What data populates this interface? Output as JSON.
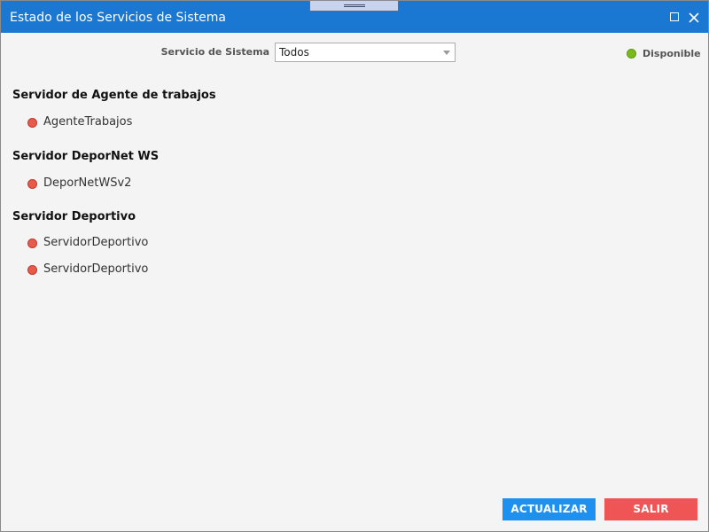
{
  "window": {
    "title": "Estado de los Servicios de Sistema"
  },
  "filter": {
    "label": "Servicio de Sistema",
    "selected": "Todos"
  },
  "legend": {
    "label": "Disponible",
    "color": "#7cba1c"
  },
  "colors": {
    "titlebar": "#1a77d2",
    "status_down": "#e85a4a",
    "refresh_button": "#1e90f0",
    "exit_button": "#ef5555"
  },
  "groups": [
    {
      "title": "Servidor de Agente de trabajos",
      "services": [
        {
          "name": "AgenteTrabajos",
          "status": "no-disponible"
        }
      ]
    },
    {
      "title": "Servidor DeporNet WS",
      "services": [
        {
          "name": "DeporNetWSv2",
          "status": "no-disponible"
        }
      ]
    },
    {
      "title": "Servidor Deportivo",
      "services": [
        {
          "name": "ServidorDeportivo",
          "status": "no-disponible"
        },
        {
          "name": "ServidorDeportivo",
          "status": "no-disponible"
        }
      ]
    }
  ],
  "buttons": {
    "refresh": "ACTUALIZAR",
    "exit": "SALIR"
  }
}
